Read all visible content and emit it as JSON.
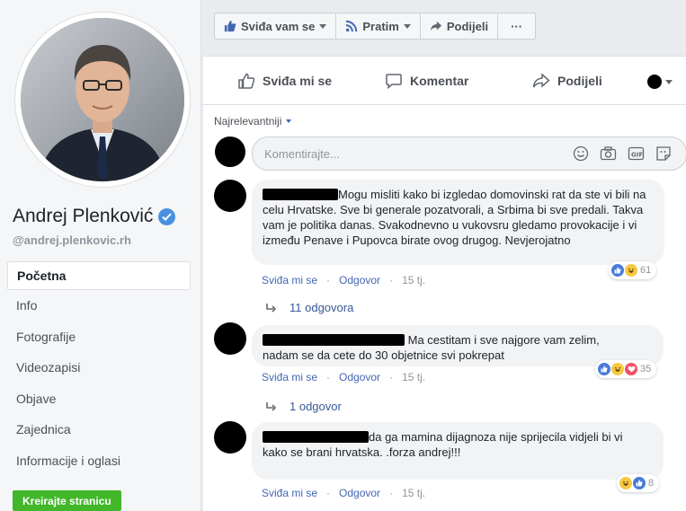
{
  "profile": {
    "name": "Andrej Plenković",
    "handle": "@andrej.plenkovic.rh"
  },
  "nav": [
    {
      "label": "Početna",
      "active": true
    },
    {
      "label": "Info"
    },
    {
      "label": "Fotografije"
    },
    {
      "label": "Videozapisi"
    },
    {
      "label": "Objave"
    },
    {
      "label": "Zajednica"
    },
    {
      "label": "Informacije i oglasi"
    }
  ],
  "create_page_label": "Kreirajte stranicu",
  "actionbar": {
    "like": "Sviđa vam se",
    "follow": "Pratim",
    "share": "Podijeli",
    "more": "···"
  },
  "post_actions": {
    "like": "Sviđa mi se",
    "comment": "Komentar",
    "share": "Podijeli"
  },
  "sort_label": "Najrelevantniji",
  "comment_input": {
    "placeholder": "Komentirajte..."
  },
  "comments": [
    {
      "text_line1": "Mogu misliti kako bi izgledao domovinski rat da ste vi",
      "text_rest": "bili na celu Hrvatske. Sve bi generale pozatvorali, a Srbima bi sve predali. Takva vam je politika danas. Svakodnevno u vukovsru gledamo provokacije i vi između Penave i Pupovca birate ovog drugog. Nevjerojatno",
      "like": "Sviđa mi se",
      "reply": "Odgovor",
      "time": "15 tj.",
      "reactions": [
        "like",
        "haha"
      ],
      "reaction_count": "61",
      "replies_label": "11 odgovora"
    },
    {
      "text_line1": "Ma cestitam i sve najgore vam zelim,",
      "text_rest": "nadam se da cete do 30 objetnice svi pokrepat",
      "like": "Sviđa mi se",
      "reply": "Odgovor",
      "time": "15 tj.",
      "reactions": [
        "like",
        "haha",
        "love"
      ],
      "reaction_count": "35",
      "replies_label": "1 odgovor"
    },
    {
      "text_line1": "da ga mamina dijagnoza nije sprijecila vidjeli bi vi",
      "text_rest": "kako se brani hrvatska. .forza andrej!!!",
      "like": "Sviđa mi se",
      "reply": "Odgovor",
      "time": "15 tj.",
      "reactions": [
        "haha",
        "like"
      ],
      "reaction_count": "8"
    }
  ],
  "colors": {
    "link": "#4267b2",
    "green": "#42b72a",
    "verified": "#4a90e2"
  }
}
